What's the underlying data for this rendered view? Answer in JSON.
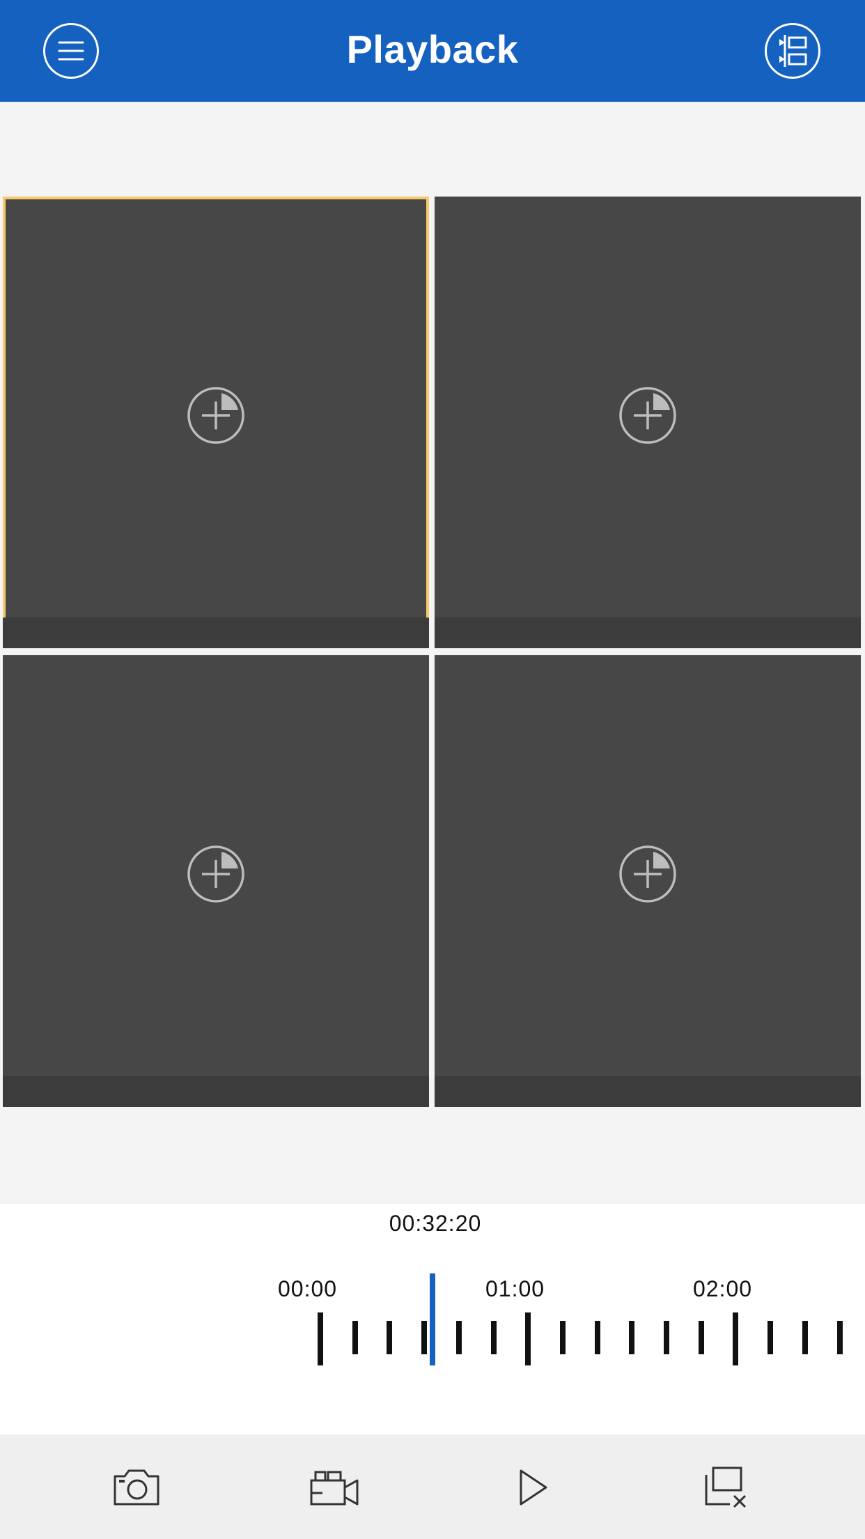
{
  "header": {
    "title": "Playback",
    "menu_icon": "hamburger-menu-icon",
    "list_icon": "device-list-icon",
    "color": "#1461c0"
  },
  "grid": {
    "cells": [
      {
        "selected": true,
        "icon": "add-camera-icon"
      },
      {
        "selected": false,
        "icon": "add-camera-icon"
      },
      {
        "selected": false,
        "icon": "add-camera-icon"
      },
      {
        "selected": false,
        "icon": "add-camera-icon"
      }
    ],
    "selected_border_color": "#f6c96c"
  },
  "timeline": {
    "current_time": "00:32:20",
    "labels": [
      "00:00",
      "01:00",
      "02:00"
    ],
    "cursor_color": "#1461c0"
  },
  "toolbar": {
    "buttons": [
      {
        "icon": "camera-icon"
      },
      {
        "icon": "video-record-icon"
      },
      {
        "icon": "play-icon"
      },
      {
        "icon": "close-all-windows-icon"
      }
    ]
  }
}
